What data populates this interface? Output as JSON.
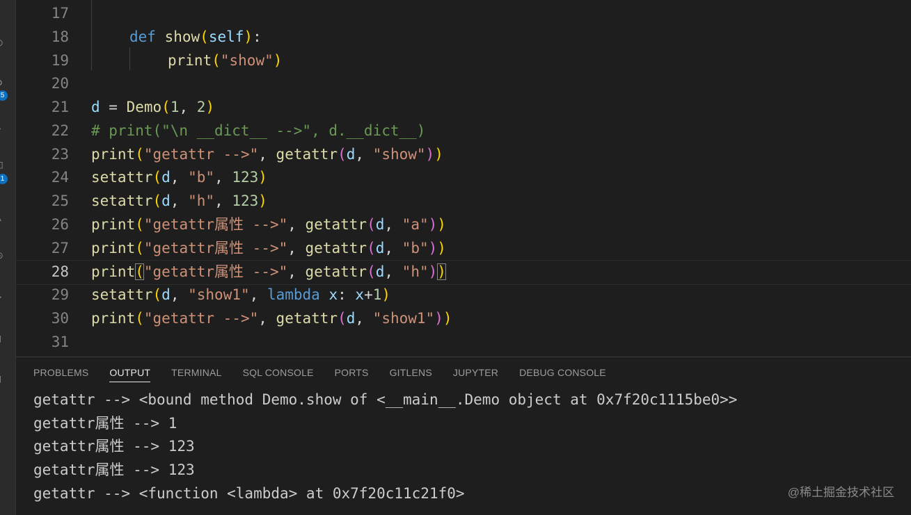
{
  "activity_bar": {
    "badges": [
      "5",
      "1"
    ]
  },
  "editor": {
    "lines": [
      {
        "num": "17",
        "code": ""
      },
      {
        "num": "18",
        "code": "def show(self):"
      },
      {
        "num": "19",
        "code": "print(\"show\")"
      },
      {
        "num": "20",
        "code": ""
      },
      {
        "num": "21",
        "code": "d = Demo(1, 2)"
      },
      {
        "num": "22",
        "code": "# print(\"\\n __dict__ -->\", d.__dict__)"
      },
      {
        "num": "23",
        "code": "print(\"getattr -->\", getattr(d, \"show\"))"
      },
      {
        "num": "24",
        "code": "setattr(d, \"b\", 123)"
      },
      {
        "num": "25",
        "code": "setattr(d, \"h\", 123)"
      },
      {
        "num": "26",
        "code": "print(\"getattr属性 -->\", getattr(d, \"a\"))"
      },
      {
        "num": "27",
        "code": "print(\"getattr属性 -->\", getattr(d, \"b\"))"
      },
      {
        "num": "28",
        "code": "print(\"getattr属性 -->\", getattr(d, \"h\"))"
      },
      {
        "num": "29",
        "code": "setattr(d, \"show1\", lambda x: x+1)"
      },
      {
        "num": "30",
        "code": "print(\"getattr -->\", getattr(d, \"show1\"))"
      },
      {
        "num": "31",
        "code": ""
      }
    ],
    "current_line": "28"
  },
  "panel": {
    "tabs": [
      "PROBLEMS",
      "OUTPUT",
      "TERMINAL",
      "SQL CONSOLE",
      "PORTS",
      "GITLENS",
      "JUPYTER",
      "DEBUG CONSOLE"
    ],
    "active_tab": "OUTPUT",
    "output": [
      "getattr --> <bound method Demo.show of <__main__.Demo object at 0x7f20c1115be0>>",
      "getattr属性 --> 1",
      "getattr属性 --> 123",
      "getattr属性 --> 123",
      "getattr --> <function <lambda> at 0x7f20c11c21f0>"
    ]
  },
  "watermark": "@稀土掘金技术社区",
  "colors": {
    "background": "#1e1e1e",
    "keyword": "#569cd6",
    "function": "#dcdcaa",
    "string": "#ce9178",
    "number": "#b5cea8",
    "comment": "#6a9955",
    "bracket_gold": "#ffd700",
    "bracket_purple": "#da70d6"
  }
}
